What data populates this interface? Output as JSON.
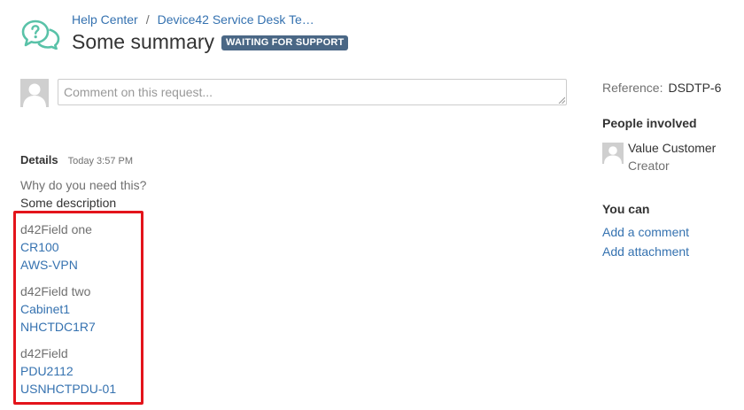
{
  "breadcrumb": {
    "items": [
      "Help Center",
      "Device42 Service Desk Te…"
    ],
    "separator": "/"
  },
  "request": {
    "title": "Some summary",
    "status": "WAITING FOR SUPPORT"
  },
  "comment": {
    "placeholder": "Comment on this request..."
  },
  "details": {
    "label": "Details",
    "time": "Today 3:57 PM",
    "question": "Why do you need this?",
    "answer": "Some description",
    "fields": [
      {
        "label": "d42Field one",
        "values": [
          "CR100",
          "AWS-VPN"
        ]
      },
      {
        "label": "d42Field two",
        "values": [
          "Cabinet1",
          "NHCTDC1R7"
        ]
      },
      {
        "label": "d42Field",
        "values": [
          "PDU2112",
          "USNHCTPDU-01"
        ]
      }
    ]
  },
  "sidebar": {
    "reference_label": "Reference:",
    "reference_value": "DSDTP-6",
    "people_heading": "People involved",
    "person_name": "Value Customer",
    "person_role": "Creator",
    "you_can_heading": "You can",
    "actions": [
      "Add a comment",
      "Add attachment"
    ]
  },
  "colors": {
    "link": "#3572b0",
    "status_badge": "#4a6785",
    "highlight": "#e3141b",
    "logo": "#59c2a8"
  },
  "icons": {
    "logo": "help-center-chat-bubbles-icon",
    "avatar": "default-user-avatar-icon"
  }
}
